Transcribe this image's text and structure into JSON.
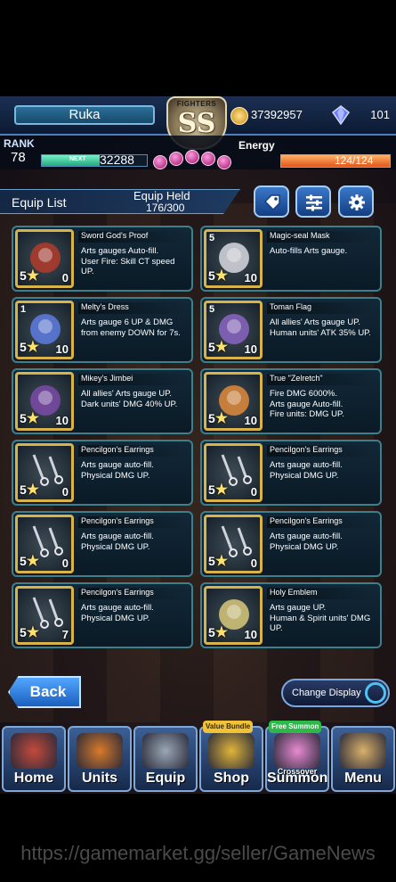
{
  "player": {
    "name": "Ruka",
    "rank_label": "RANK",
    "rank": "78",
    "next_label": "NEXT",
    "next_exp": "32288",
    "exp_fraction": 0.55
  },
  "badge": {
    "title": "FIGHTERS",
    "grade": "SS"
  },
  "currency": {
    "gold": "37392957",
    "gems": "101"
  },
  "energy": {
    "label": "Energy",
    "value": "124/124",
    "fraction": 1.0
  },
  "header": {
    "title": "Equip List",
    "held_label": "Equip Held",
    "held_value": "176/300"
  },
  "toolbar": {
    "icons": [
      "tag-icon",
      "filter-icon",
      "gear-icon"
    ]
  },
  "equipment": [
    {
      "name": "Sword God's Proof",
      "desc": "Arts gauges Auto-fill.\nUser Fire: Skill CT speed UP.",
      "stars": "5",
      "level": "0",
      "rarity": ""
    },
    {
      "name": "Magic-seal Mask",
      "desc": "Auto-fills Arts gauge.",
      "stars": "5",
      "level": "10",
      "rarity": "5"
    },
    {
      "name": "Melty's Dress",
      "desc": "Arts gauge 6 UP & DMG from enemy DOWN for 7s.",
      "stars": "5",
      "level": "10",
      "rarity": "1"
    },
    {
      "name": "Toman Flag",
      "desc": "All allies' Arts gauge UP.\nHuman units' ATK 35% UP.",
      "stars": "5",
      "level": "10",
      "rarity": "5"
    },
    {
      "name": "Mikey's Jimbei",
      "desc": "All allies' Arts gauge UP.\nDark units' DMG 40% UP.",
      "stars": "5",
      "level": "10",
      "rarity": ""
    },
    {
      "name": "True \"Zelretch\"",
      "desc": "Fire DMG 6000%.\nArts gauge Auto-fill.\nFire units: DMG UP.",
      "stars": "5",
      "level": "10",
      "rarity": ""
    },
    {
      "name": "Pencilgon's Earrings",
      "desc": "Arts gauge auto-fill.\nPhysical DMG UP.",
      "stars": "5",
      "level": "0",
      "rarity": ""
    },
    {
      "name": "Pencilgon's Earrings",
      "desc": "Arts gauge auto-fill.\nPhysical DMG UP.",
      "stars": "5",
      "level": "0",
      "rarity": ""
    },
    {
      "name": "Pencilgon's Earrings",
      "desc": "Arts gauge auto-fill.\nPhysical DMG UP.",
      "stars": "5",
      "level": "0",
      "rarity": ""
    },
    {
      "name": "Pencilgon's Earrings",
      "desc": "Arts gauge auto-fill.\nPhysical DMG UP.",
      "stars": "5",
      "level": "0",
      "rarity": ""
    },
    {
      "name": "Pencilgon's Earrings",
      "desc": "Arts gauge auto-fill.\nPhysical DMG UP.",
      "stars": "5",
      "level": "7",
      "rarity": ""
    },
    {
      "name": "Holy Emblem",
      "desc": "Arts gauge UP.\nHuman & Spirit units' DMG UP.",
      "stars": "5",
      "level": "10",
      "rarity": ""
    }
  ],
  "buttons": {
    "back": "Back",
    "change_display": "Change Display"
  },
  "nav": [
    {
      "label": "Home",
      "badge": ""
    },
    {
      "label": "Units",
      "badge": ""
    },
    {
      "label": "Equip",
      "badge": ""
    },
    {
      "label": "Shop",
      "badge": "Value Bundle"
    },
    {
      "label": "Summon",
      "badge": "Free Summon",
      "sub": "Crossover"
    },
    {
      "label": "Menu",
      "badge": ""
    }
  ],
  "watermark": "https://gamemarket.gg/seller/GameNews",
  "colors": {
    "accent": "#4f7fbf",
    "card_border": "#3e7f8c",
    "gold_frame": "#d9b34a",
    "energy": "#e0561b"
  }
}
